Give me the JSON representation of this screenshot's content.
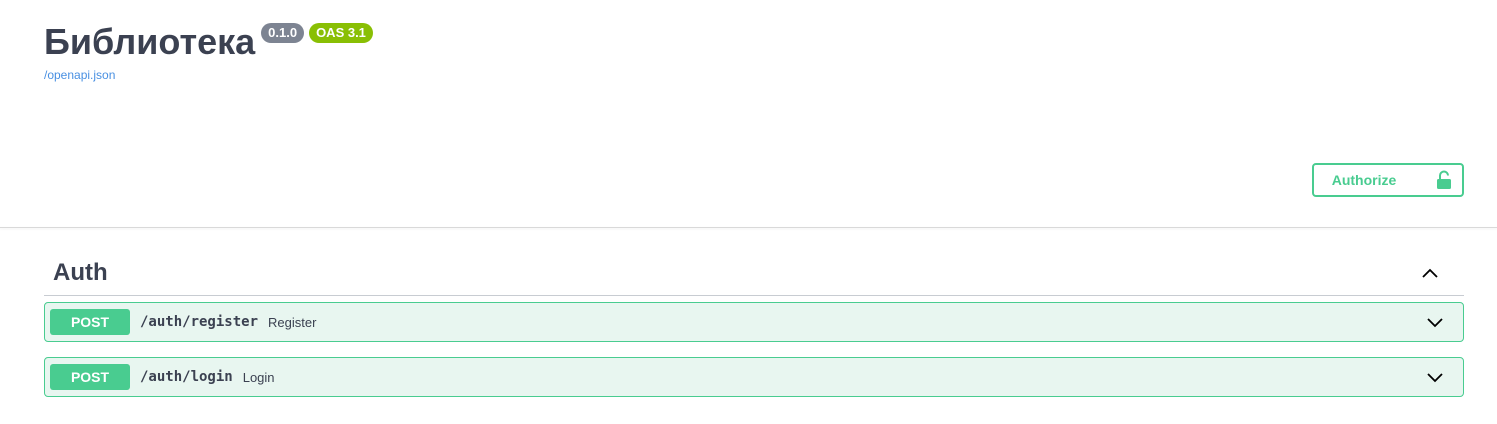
{
  "info": {
    "title": "Библиотека",
    "version_badge": "0.1.0",
    "oas_badge": "OAS 3.1",
    "spec_link": "/openapi.json"
  },
  "authorize": {
    "label": "Authorize",
    "icon": "unlocked-icon"
  },
  "colors": {
    "post_green": "#49cc90",
    "post_bg": "#e8f6f0",
    "version_grey": "#7d8492",
    "oas_green": "#89bf04",
    "link_blue": "#4990e2",
    "text": "#3b4151"
  },
  "tags": [
    {
      "name": "Auth",
      "expanded": true,
      "operations": [
        {
          "method": "POST",
          "path": "/auth/register",
          "summary": "Register"
        },
        {
          "method": "POST",
          "path": "/auth/login",
          "summary": "Login"
        }
      ]
    }
  ]
}
